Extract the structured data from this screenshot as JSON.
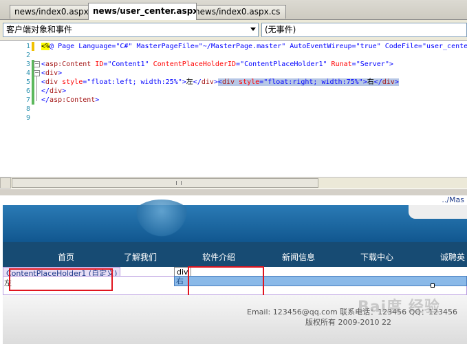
{
  "tabs": [
    {
      "label": "news/index0.aspx",
      "active": false
    },
    {
      "label": "news/user_center.aspx",
      "active": true
    },
    {
      "label": "news/index0.aspx.cs",
      "active": false
    }
  ],
  "dropdowns": {
    "objects": "客户端对象和事件",
    "events": "(无事件)"
  },
  "code_lines": [
    {
      "num": "1",
      "text": "<%@ Page Language=\"C#\" MasterPageFile=\"~/MasterPage.master\" AutoEventWireup=\"true\" CodeFile=\"user_cente"
    },
    {
      "num": "2",
      "text": ""
    },
    {
      "num": "3",
      "text": "<asp:Content ID=\"Content1\" ContentPlaceHolderID=\"ContentPlaceHolder1\" Runat=\"Server\">"
    },
    {
      "num": "4",
      "text": "<div>"
    },
    {
      "num": "5",
      "text": "<div style=\"float:left; width:25%\">左</div><div style=\"float:right; width:75%\">右</div>"
    },
    {
      "num": "6",
      "text": "</div>"
    },
    {
      "num": "7",
      "text": "</asp:Content>"
    },
    {
      "num": "8",
      "text": ""
    },
    {
      "num": "9",
      "text": ""
    }
  ],
  "breadcrumb": "../Mas",
  "nav": [
    "首页",
    "了解我们",
    "软件介绍",
    "新闻信息",
    "下载中心",
    "诚聘英"
  ],
  "placeholder_label": "ContentPlaceHolder1 (自定义)",
  "div_tag": "div",
  "left_text": "左",
  "right_text": "右",
  "footer": {
    "line1": "Email: 123456@qq.com 联系电话：123456 QQ：123456",
    "line2": "版权所有 2009-2010 22"
  },
  "watermark": "Bai度 经验",
  "colors": {
    "highlight_box": "#e0141e",
    "banner": "#1b64a0",
    "nav": "#174b73"
  }
}
